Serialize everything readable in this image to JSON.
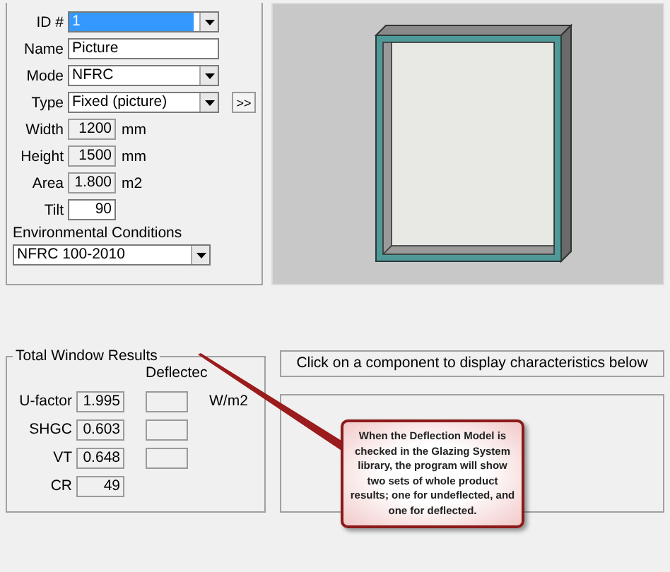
{
  "fields": [
    {
      "kind": "select",
      "label": "ID #",
      "value": "1",
      "highlighted": true
    },
    {
      "kind": "text",
      "label": "Name",
      "value": "Picture"
    },
    {
      "kind": "select",
      "label": "Mode",
      "value": "NFRC",
      "highlighted": false
    },
    {
      "kind": "select",
      "label": "Type",
      "value": "Fixed (picture)",
      "highlighted": false,
      "button": ">>"
    },
    {
      "kind": "readonly",
      "label": "Width",
      "value": "1200",
      "unit": "mm"
    },
    {
      "kind": "readonly",
      "label": "Height",
      "value": "1500",
      "unit": "mm"
    },
    {
      "kind": "readonly",
      "label": "Area",
      "value": "1.800",
      "unit": "m2"
    },
    {
      "kind": "number",
      "label": "Tilt",
      "value": "90"
    }
  ],
  "environmental_conditions": {
    "label": "Environmental Conditions",
    "value": "NFRC 100-2010"
  },
  "results": {
    "title": "Total Window Results",
    "deflected_header": "Deflectec",
    "unit": "W/m2",
    "rows": [
      {
        "label": "U-factor",
        "value": "1.995",
        "deflected_field": true
      },
      {
        "label": "SHGC",
        "value": "0.603",
        "deflected_field": true
      },
      {
        "label": "VT",
        "value": "0.648",
        "deflected_field": true
      },
      {
        "label": "CR",
        "value": "49",
        "deflected_field": false
      }
    ]
  },
  "component_hint": "Click on a component to display characteristics below",
  "callout": "When the Deflection Model is checked in the Glazing System library, the program will show two sets of whole product results; one for undeflected, and one for deflected."
}
